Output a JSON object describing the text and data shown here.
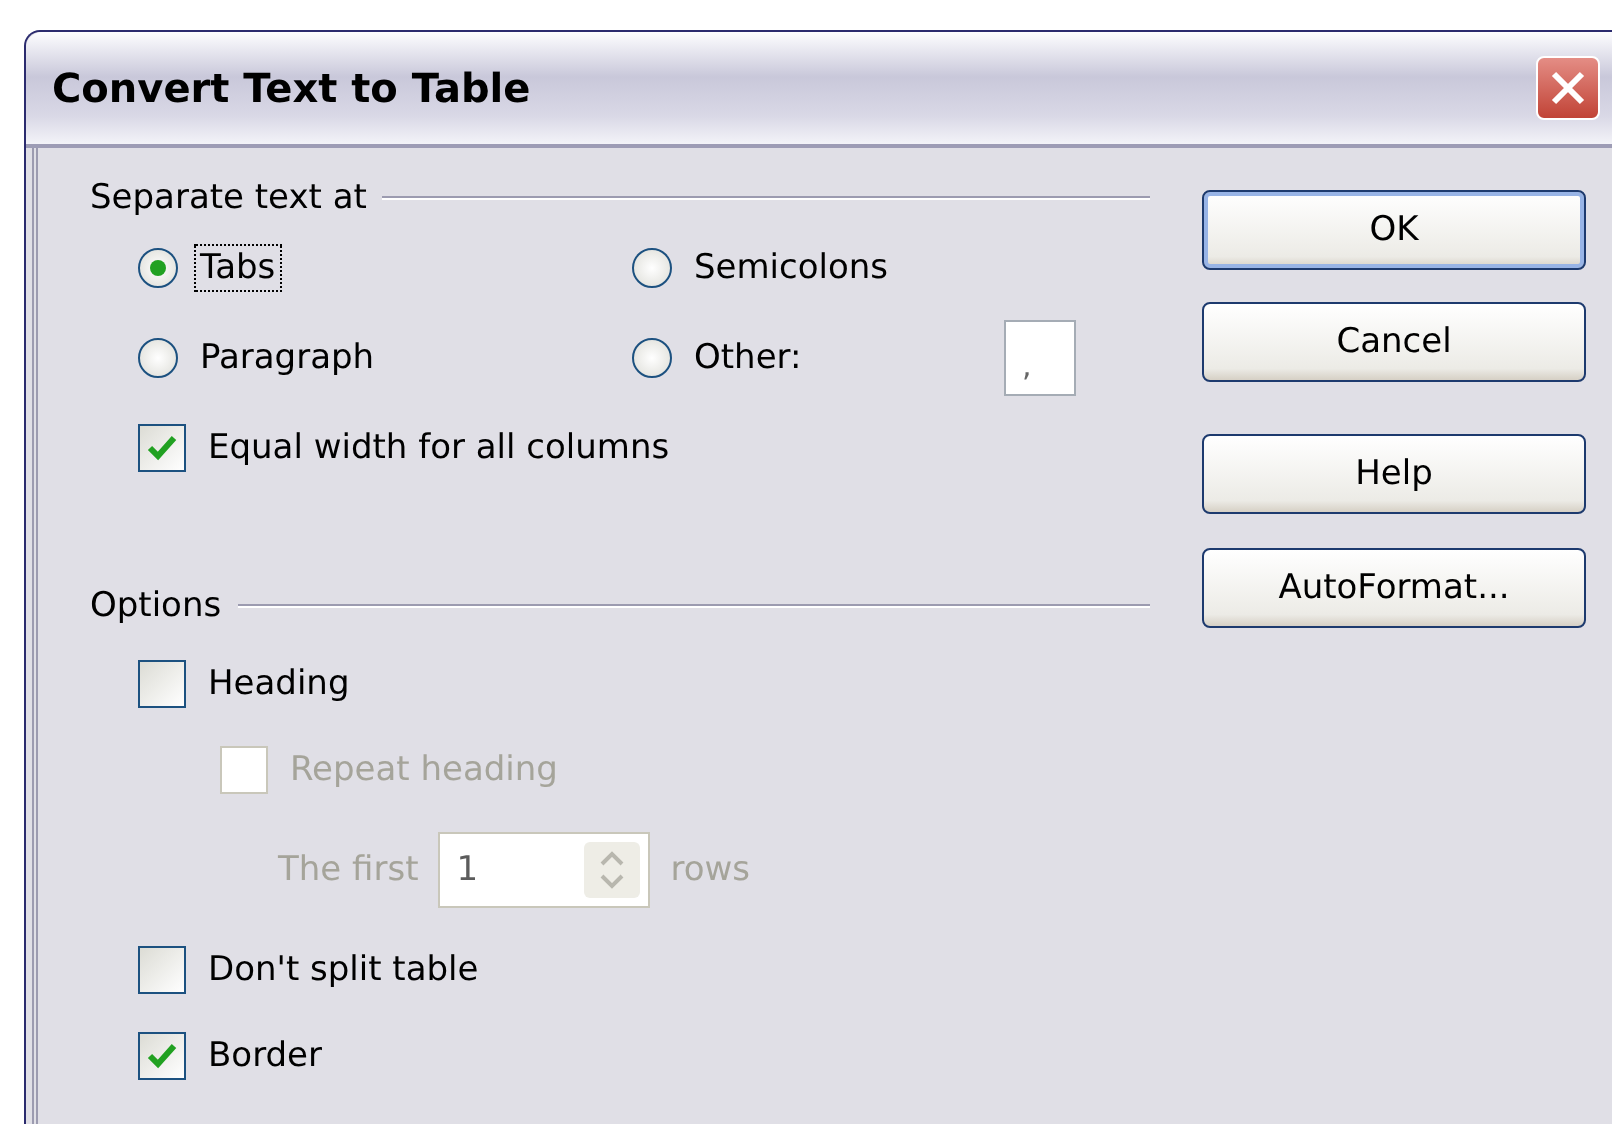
{
  "window": {
    "title": "Convert Text to Table"
  },
  "separate": {
    "label": "Separate text at",
    "choices": [
      {
        "label": "Tabs",
        "selected": true,
        "focused": true
      },
      {
        "label": "Semicolons",
        "selected": false,
        "focused": false
      },
      {
        "label": "Paragraph",
        "selected": false,
        "focused": false
      },
      {
        "label": "Other:",
        "selected": false,
        "focused": false
      }
    ],
    "other_value": ",",
    "equal_width": {
      "label": "Equal width for all columns",
      "checked": true
    }
  },
  "options": {
    "label": "Options",
    "items": [
      {
        "kind": "checkbox",
        "label": "Heading",
        "checked": false,
        "disabled": false,
        "indented": false
      },
      {
        "kind": "checkbox",
        "label": "Repeat heading",
        "checked": false,
        "disabled": true,
        "indented": true
      },
      {
        "kind": "spin",
        "label": "The first",
        "value": "1",
        "suffix": "rows",
        "disabled": true
      },
      {
        "kind": "checkbox",
        "label": "Don't split table",
        "checked": false,
        "disabled": false,
        "indented": false
      },
      {
        "kind": "checkbox",
        "label": "Border",
        "checked": true,
        "disabled": false,
        "indented": false
      }
    ]
  },
  "buttons": [
    {
      "label": "OK",
      "default": true
    },
    {
      "label": "Cancel",
      "default": false
    },
    {
      "label": "Help",
      "default": false
    },
    {
      "label": "AutoFormat...",
      "default": false
    }
  ]
}
